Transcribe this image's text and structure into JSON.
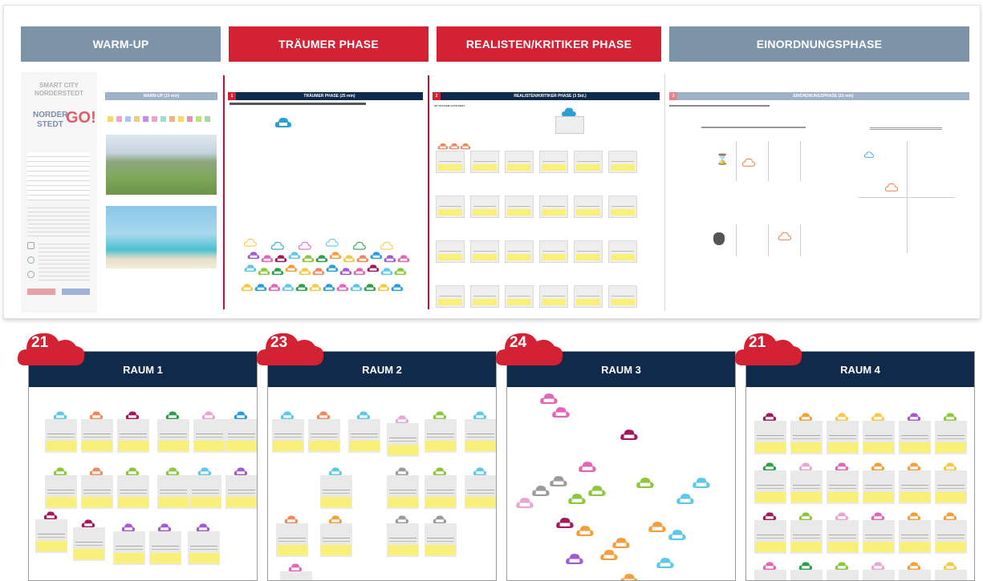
{
  "phases": [
    {
      "title": "WARM-UP",
      "color": "#7d93a8"
    },
    {
      "title": "TRÄUMER PHASE",
      "color": "#d22233"
    },
    {
      "title": "REALISTEN/KRITIKER PHASE",
      "color": "#d22233"
    },
    {
      "title": "EINORDNUNGSPHASE",
      "color": "#7d93a8"
    }
  ],
  "warmup": {
    "logo_line1": "SMART CITY",
    "logo_line2": "NORDERSTEDT",
    "logo_go1": "NORDER",
    "logo_go2": "STEDT",
    "logo_go3": "GO!",
    "bar_title": "WARM-UP (10 min)"
  },
  "traeumer": {
    "num": "1",
    "bar_title": "TRÄUMER PHASE  (25 min)"
  },
  "realisten": {
    "num": "2",
    "bar_title": "REALISTEN/KRITIKER PHASE (3 Std.)",
    "question": "IST DAS EINE GUTE IDEE?"
  },
  "einordnung": {
    "num": "3",
    "bar_title": "EINORDNUNGSPHASE (10 min)"
  },
  "rooms": [
    {
      "name": "RAUM 1",
      "count": "21"
    },
    {
      "name": "RAUM 2",
      "count": "23"
    },
    {
      "name": "RAUM 3",
      "count": "24"
    },
    {
      "name": "RAUM 4",
      "count": "21"
    }
  ],
  "colors": {
    "navy": "#0f2a4a",
    "red": "#d22233",
    "gray_blue": "#7d93a8",
    "sticky_yellow": "#f9f07a"
  }
}
